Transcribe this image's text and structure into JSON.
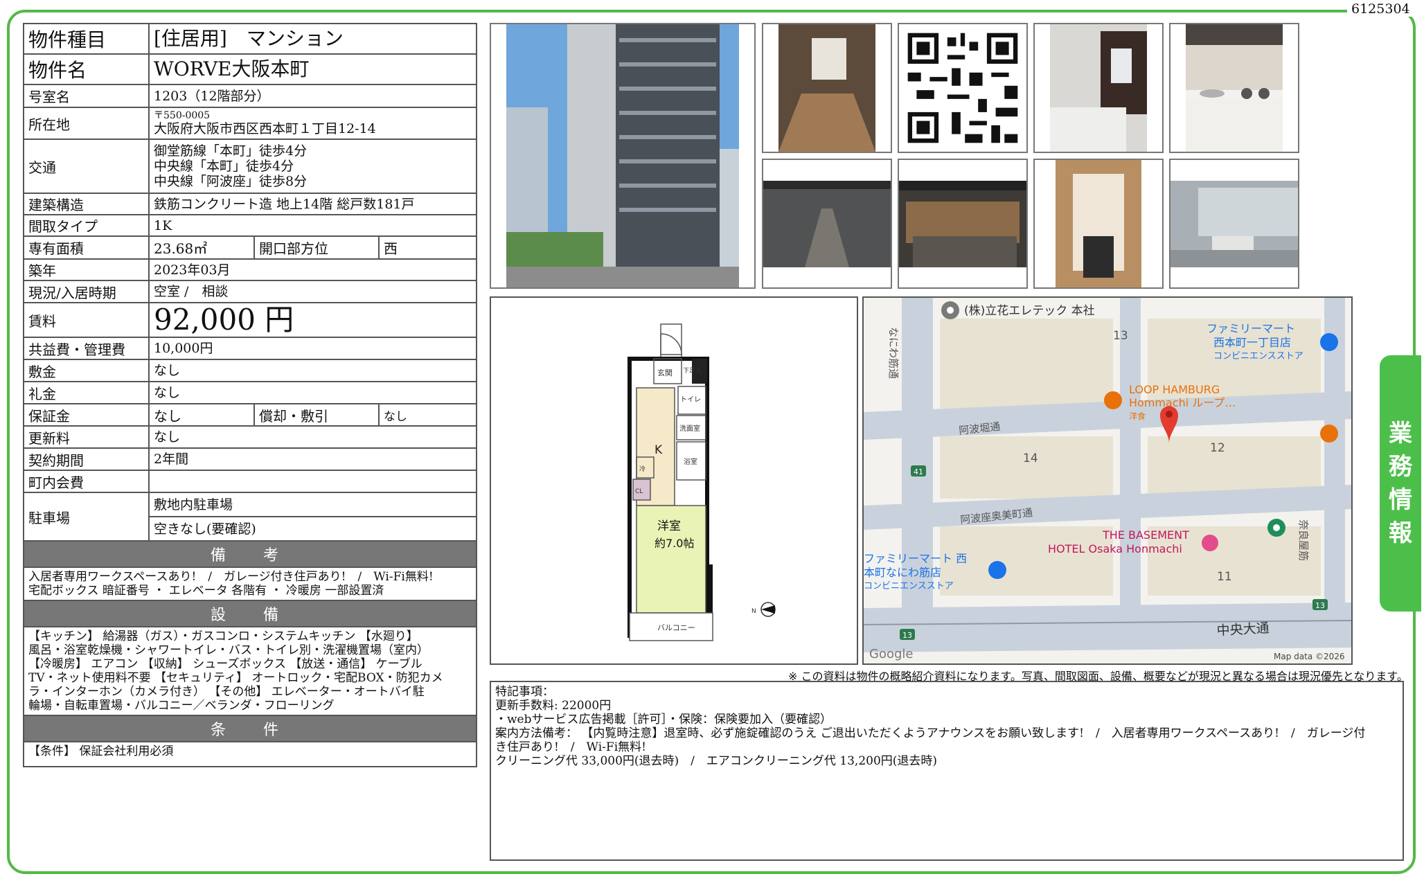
{
  "doc_id": "6125304",
  "side_tab": [
    "業",
    "務",
    "情",
    "報"
  ],
  "property": {
    "type_label": "物件種目",
    "type_value": "[住居用]　マンション",
    "name_label": "物件名",
    "name_value": "WORVE大阪本町",
    "room_label": "号室名",
    "room_value": "1203（12階部分）",
    "address_label": "所在地",
    "postal": "〒550-0005",
    "address": "大阪府大阪市西区西本町１丁目12-14",
    "access_label": "交通",
    "access": [
      "御堂筋線「本町」徒歩4分",
      "中央線「本町」徒歩4分",
      "中央線「阿波座」徒歩8分"
    ],
    "structure_label": "建築構造",
    "structure_value": "鉄筋コンクリート造 地上14階 総戸数181戸",
    "layout_label": "間取タイプ",
    "layout_value": "1K",
    "area_label": "専有面積",
    "area_value": "23.68㎡",
    "direction_label": "開口部方位",
    "direction_value": "西",
    "built_label": "築年",
    "built_value": "2023年03月",
    "status_label": "現況/入居時期",
    "status_value": "空室 /　相談",
    "rent_label": "賃料",
    "rent_value": "92,000 円",
    "fee_label": "共益費・管理費",
    "fee_value": "10,000円",
    "deposit_label": "敷金",
    "deposit_value": "なし",
    "key_money_label": "礼金",
    "key_money_value": "なし",
    "guarantee_label": "保証金",
    "guarantee_value": "なし",
    "amort_label": "償却・敷引",
    "amort_value": "なし",
    "renewal_label": "更新料",
    "renewal_value": "なし",
    "term_label": "契約期間",
    "term_value": "2年間",
    "town_fee_label": "町内会費",
    "town_fee_value": "",
    "parking_label": "駐車場",
    "parking_value1": "敷地内駐車場",
    "parking_value2": "空きなし(要確認)"
  },
  "remarks_title": "備　考",
  "remarks_text": [
    "入居者専用ワークスペースあり!　/　ガレージ付き住戸あり!　/　Wi-Fi無料!",
    "宅配ボックス 暗証番号 ・ エレベータ 各階有 ・ 冷暖房 一部設置済"
  ],
  "equipment_title": "設　備",
  "equipment_text": [
    "【キッチン】 給湯器（ガス）・ガスコンロ・システムキッチン 【水廻り】",
    "風呂・浴室乾燥機・シャワートイレ・バス・トイレ別・洗濯機置場（室内）",
    "【冷暖房】 エアコン 【収納】 シューズボックス 【放送・通信】 ケーブル",
    "TV・ネット使用料不要 【セキュリティ】 オートロック・宅配BOX・防犯カメ",
    "ラ・インターホン（カメラ付き） 【その他】 エレベーター・オートバイ駐",
    "輪場・自転車置場・バルコニー／ベランダ・フローリング"
  ],
  "conditions_title": "条　件",
  "conditions_text": "【条件】 保証会社利用必須",
  "floorplan": {
    "entrance": "玄関",
    "shoes": "下足入",
    "toilet": "トイレ",
    "wash": "洗面室",
    "bath": "浴室",
    "kitchen": "K",
    "cold": "冷",
    "closet": "CL",
    "room": "洋室",
    "room_size": "約7.0帖",
    "balcony": "バルコニー",
    "north": "N"
  },
  "map": {
    "poi1": "(株)立花エレテック 本社",
    "poi2": "ファミリーマート",
    "poi2b": "西本町一丁目店",
    "poi2c": "コンビニエンスストア",
    "poi3": "LOOP HAMBURG",
    "poi3b": "Hommachi ループ…",
    "poi3c": "洋食",
    "street1": "阿波堀通",
    "street2": "阿波座奥美町通",
    "street3": "なにわ筋通",
    "street4": "奈良屋筋",
    "poi4": "THE BASEMENT",
    "poi4b": "HOTEL Osaka Honmachi",
    "poi5": "ファミリーマート 西",
    "poi5b": "本町なにわ筋店",
    "poi5c": "コンビニエンスストア",
    "block13": "13",
    "block14": "14",
    "block12": "12",
    "block11": "11",
    "route41": "41",
    "route13a": "13",
    "route13b": "13",
    "road": "中央大通",
    "logo": "Google",
    "attribution": "Map data ©2026"
  },
  "disclaimer": "※ この資料は物件の概略紹介資料になります。写真、間取図面、設備、概要などが現況と異なる場合は現況優先となります。",
  "notes": {
    "title": "特記事項：",
    "lines": [
      "更新手数料: 22000円",
      "・webサービス広告掲載［許可］・保険：保険要加入（要確認）",
      "案内方法備考： 【内覧時注意】退室時、必ず施錠確認のうえ ご退出いただくようアナウンスをお願い致します!　/　入居者専用ワークスペースあり!　/　ガレージ付",
      "き住戸あり!　/　Wi-Fi無料!",
      "クリーニング代 33,000円(退去時)　/　エアコンクリーニング代 13,200円(退去時)"
    ]
  }
}
